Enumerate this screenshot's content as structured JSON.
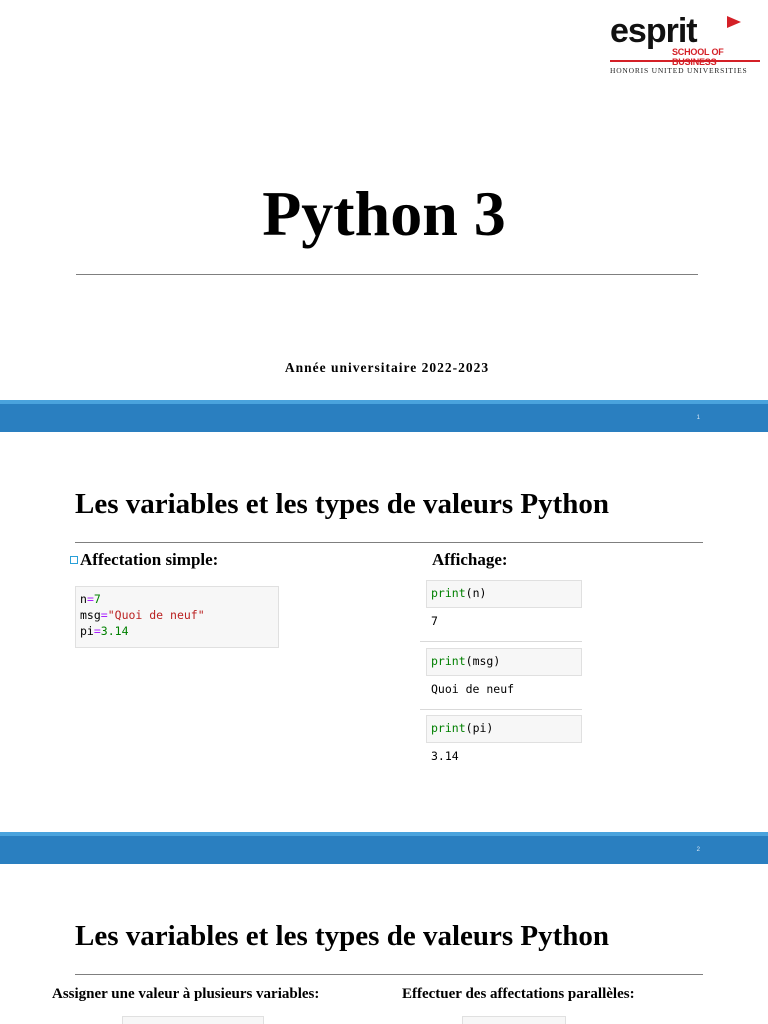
{
  "slide1": {
    "logo": {
      "word": "esprit",
      "school": "SCHOOL OF BUSINESS",
      "network": "HONORIS UNITED UNIVERSITIES"
    },
    "title": "Python 3",
    "year": "Année universitaire 2022-2023",
    "page_number": "1"
  },
  "slide2": {
    "heading": "Les variables et les types de valeurs Python",
    "left_label": "Affectation simple:",
    "right_label": "Affichage:",
    "assign_code": {
      "line1": {
        "name": "n",
        "op": "=",
        "value": "7"
      },
      "line2": {
        "name": "msg",
        "op": "=",
        "value": "\"Quoi de neuf\""
      },
      "line3": {
        "name": "pi",
        "op": "=",
        "value": "3.14"
      }
    },
    "outputs": [
      {
        "func": "print",
        "arg": "n",
        "result": "7"
      },
      {
        "func": "print",
        "arg": "msg",
        "result": "Quoi de neuf"
      },
      {
        "func": "print",
        "arg": "pi",
        "result": "3.14"
      }
    ],
    "page_number": "2"
  },
  "slide3": {
    "heading": "Les variables et les types de valeurs Python",
    "left_label": "Assigner une valeur à plusieurs variables:",
    "right_label": "Effectuer des affectations parallèles:"
  },
  "colors": {
    "band": "#2a7fc0",
    "brand_red": "#d42027",
    "code_keyword": "#008000",
    "code_string": "#ba2121"
  }
}
